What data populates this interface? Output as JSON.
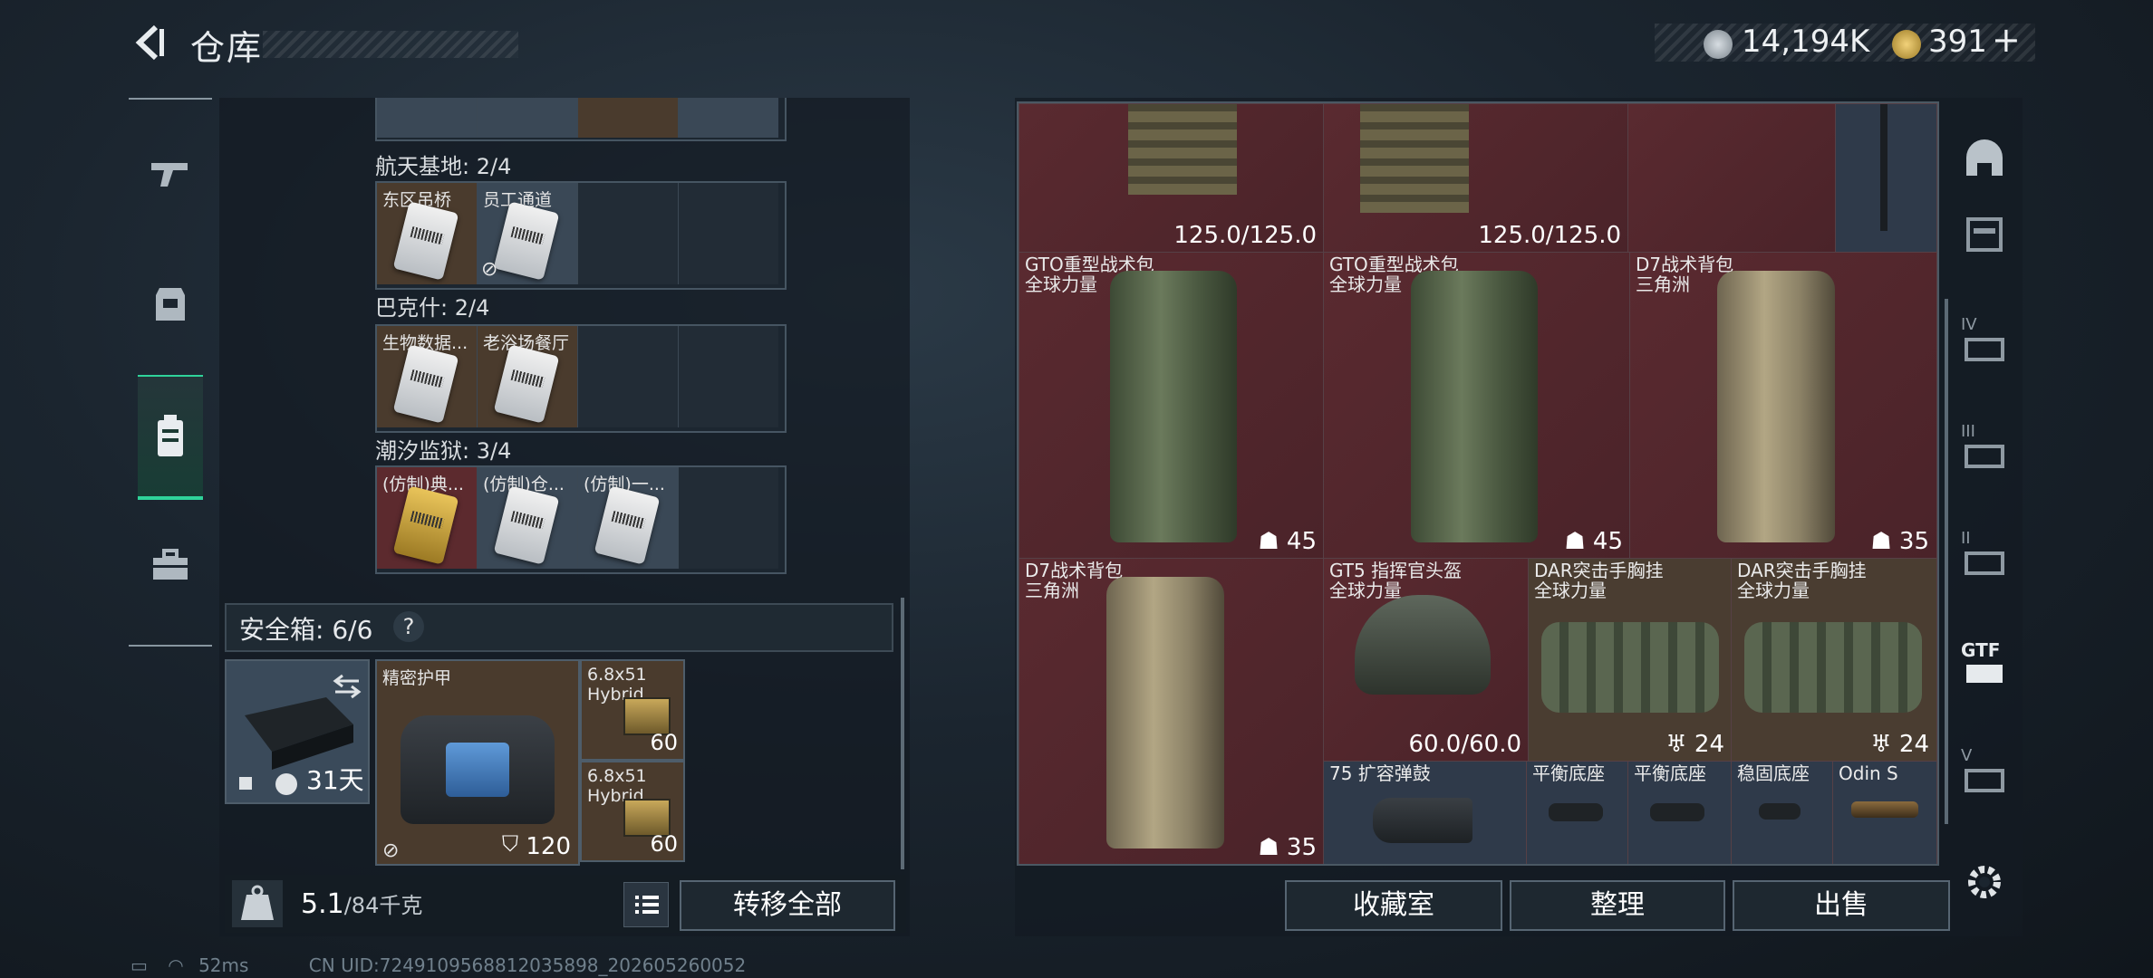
{
  "header": {
    "title": "仓库",
    "currency_primary": "14,194K",
    "currency_secondary": "391",
    "add_symbol": "+"
  },
  "left_nav": {
    "items": [
      {
        "name": "weapons",
        "icon": "gun-icon"
      },
      {
        "name": "equipment",
        "icon": "armor-icon"
      },
      {
        "name": "keys",
        "icon": "keycard-holder-icon",
        "active": true
      },
      {
        "name": "containers",
        "icon": "briefcase-icon"
      }
    ]
  },
  "key_groups": [
    {
      "label": "航天基地: 2/4",
      "slots": [
        {
          "label": "东区吊桥",
          "color": "brown"
        },
        {
          "label": "员工通道",
          "color": "blue",
          "nosell": true
        },
        {
          "label": "",
          "color": "empty"
        },
        {
          "label": "",
          "color": "empty"
        }
      ]
    },
    {
      "label": "巴克什: 2/4",
      "slots": [
        {
          "label": "生物数据...",
          "color": "brown"
        },
        {
          "label": "老浴场餐厅",
          "color": "brown"
        },
        {
          "label": "",
          "color": "empty"
        },
        {
          "label": "",
          "color": "empty"
        }
      ]
    },
    {
      "label": "潮汐监狱: 3/4",
      "slots": [
        {
          "label": "(仿制)典...",
          "color": "red",
          "gold": true
        },
        {
          "label": "(仿制)仓...",
          "color": "blue"
        },
        {
          "label": "(仿制)一...",
          "color": "blue"
        },
        {
          "label": "",
          "color": "empty"
        }
      ]
    }
  ],
  "safebox": {
    "label": "安全箱: 6/6",
    "help": "?",
    "days": "31天",
    "armor_name": "精密护甲",
    "armor_value": "120",
    "ammo": [
      {
        "label": "6.8x51 Hybrid",
        "count": "60"
      },
      {
        "label": "6.8x51 Hybrid",
        "count": "60"
      }
    ]
  },
  "footer_left": {
    "weight_value": "5.1",
    "weight_cap": "/84千克",
    "transfer_all": "转移全部"
  },
  "stash": {
    "top_durability_1": "125.0/125.0",
    "top_durability_2": "125.0/125.0",
    "items": [
      {
        "name": "GTO重型战术包",
        "sub": "全球力量",
        "stat": "45"
      },
      {
        "name": "GTO重型战术包",
        "sub": "全球力量",
        "stat": "45"
      },
      {
        "name": "D7战术背包",
        "sub": "三角洲",
        "stat": "35"
      },
      {
        "name": "D7战术背包",
        "sub": "三角洲",
        "stat": "35"
      },
      {
        "name": "GT5 指挥官头盔",
        "sub": "全球力量",
        "stat": "60.0/60.0"
      },
      {
        "name": "DAR突击手胸挂",
        "sub": "全球力量",
        "stat": "24"
      },
      {
        "name": "DAR突击手胸挂",
        "sub": "全球力量",
        "stat": "24"
      },
      {
        "name": "75 扩容弹鼓",
        "sub": "",
        "stat": ""
      },
      {
        "name": "平衡底座",
        "sub": "",
        "stat": ""
      },
      {
        "name": "平衡底座",
        "sub": "",
        "stat": ""
      },
      {
        "name": "稳固底座",
        "sub": "",
        "stat": ""
      },
      {
        "name": "Odin S",
        "sub": "",
        "stat": ""
      }
    ]
  },
  "footer_right": {
    "collection": "收藏室",
    "organize": "整理",
    "sell": "出售"
  },
  "right_nav": {
    "items": [
      "helmet-icon",
      "chest-rig-icon",
      "tier-iv-armor-icon",
      "tier-iii-armor-icon",
      "tier-ii-armor-icon",
      "gtf-icon",
      "tier-v-armor-icon"
    ],
    "labels": [
      "IV",
      "III",
      "II",
      "GTF",
      "V"
    ]
  },
  "status": {
    "ping": "52ms",
    "uid": "CN UID:7249109568812035898_202605260052"
  },
  "colors": {
    "accent": "#2fd39a",
    "red_slot": "#5a2a30",
    "brown_slot": "#4a3b2d",
    "blue_slot": "#3a4856"
  }
}
